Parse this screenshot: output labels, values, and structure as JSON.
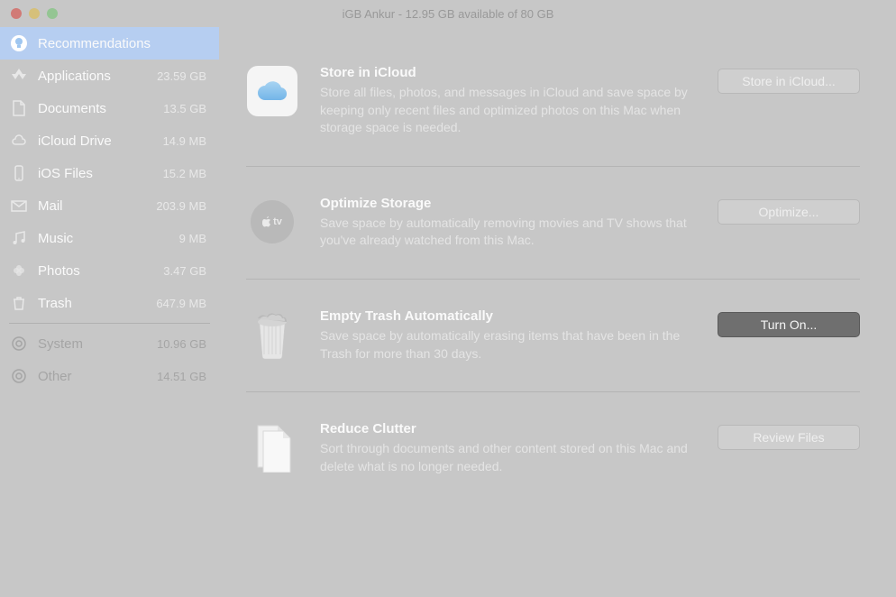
{
  "window": {
    "title": "iGB Ankur - 12.95 GB available of 80 GB"
  },
  "sidebar": {
    "items": [
      {
        "label": "Recommendations",
        "size": "",
        "icon": "bulb",
        "selected": true
      },
      {
        "label": "Applications",
        "size": "23.59 GB",
        "icon": "app"
      },
      {
        "label": "Documents",
        "size": "13.5 GB",
        "icon": "doc"
      },
      {
        "label": "iCloud Drive",
        "size": "14.9 MB",
        "icon": "cloud"
      },
      {
        "label": "iOS Files",
        "size": "15.2 MB",
        "icon": "phone"
      },
      {
        "label": "Mail",
        "size": "203.9 MB",
        "icon": "mail"
      },
      {
        "label": "Music",
        "size": "9 MB",
        "icon": "music"
      },
      {
        "label": "Photos",
        "size": "3.47 GB",
        "icon": "photos"
      },
      {
        "label": "Trash",
        "size": "647.9 MB",
        "icon": "trash"
      }
    ],
    "dimItems": [
      {
        "label": "System",
        "size": "10.96 GB",
        "icon": "gear"
      },
      {
        "label": "Other",
        "size": "14.51 GB",
        "icon": "gear"
      }
    ]
  },
  "recommendations": [
    {
      "title": "Store in iCloud",
      "desc": "Store all files, photos, and messages in iCloud and save space by keeping only recent files and optimized photos on this Mac when storage space is needed.",
      "button": "Store in iCloud...",
      "icon": "icloud",
      "dark": false
    },
    {
      "title": "Optimize Storage",
      "desc": "Save space by automatically removing movies and TV shows that you've already watched from this Mac.",
      "button": "Optimize...",
      "icon": "appletv",
      "dark": false
    },
    {
      "title": "Empty Trash Automatically",
      "desc": "Save space by automatically erasing items that have been in the Trash for more than 30 days.",
      "button": "Turn On...",
      "icon": "trashbin",
      "dark": true
    },
    {
      "title": "Reduce Clutter",
      "desc": "Sort through documents and other content stored on this Mac and delete what is no longer needed.",
      "button": "Review Files",
      "icon": "docs",
      "dark": false
    }
  ]
}
